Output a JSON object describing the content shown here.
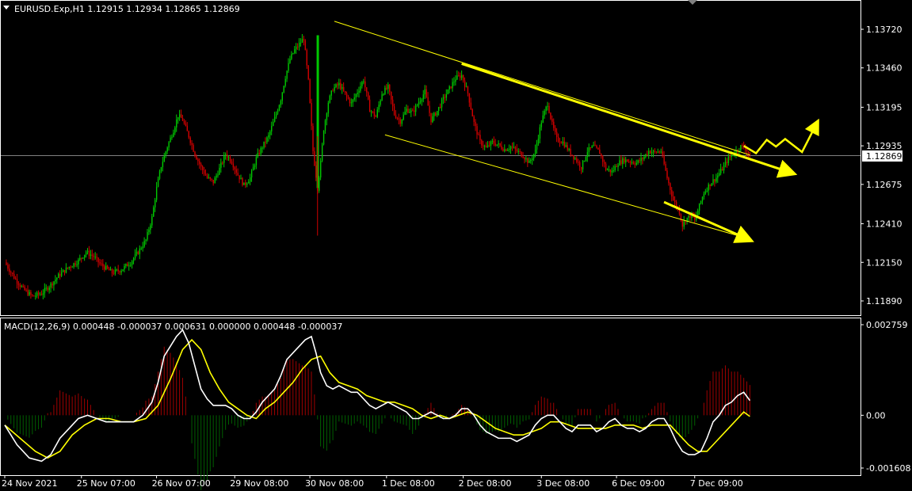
{
  "header": {
    "symbol_line": "EURUSD.Exp,H1  1.12915 1.12934 1.12865 1.12869"
  },
  "macd_header": {
    "text": "MACD(12,26,9) 0.000448 -0.000037 0.000631 0.000000 0.000448 -0.000037"
  },
  "chart_data": [
    {
      "type": "candlestick",
      "symbol": "EURUSD.Exp",
      "timeframe": "H1",
      "ohlc_current": {
        "open": 1.12915,
        "high": 1.12934,
        "low": 1.12865,
        "close": 1.12869
      },
      "current_price_label": "1.12869",
      "current_price": 1.12869,
      "y_ticks": [
        "1.13720",
        "1.13460",
        "1.13195",
        "1.12935",
        "1.12675",
        "1.12410",
        "1.12150",
        "1.11890"
      ],
      "y_tick_values": [
        1.1372,
        1.1346,
        1.13195,
        1.12935,
        1.12675,
        1.1241,
        1.1215,
        1.1189
      ],
      "x_ticks": [
        "24 Nov 2021",
        "25 Nov 07:00",
        "26 Nov 07:00",
        "29 Nov 08:00",
        "30 Nov 08:00",
        "1 Dec 08:00",
        "2 Dec 08:00",
        "3 Dec 08:00",
        "6 Dec 09:00",
        "7 Dec 09:00"
      ],
      "colors": {
        "bull": "#00c800",
        "bear": "#d00000",
        "trend": "#ffff00",
        "price_line": "#808080"
      },
      "close_path": [
        [
          0,
          1.1215
        ],
        [
          6,
          1.1205
        ],
        [
          12,
          1.1197
        ],
        [
          18,
          1.1192
        ],
        [
          24,
          1.1194
        ],
        [
          30,
          1.12
        ],
        [
          36,
          1.1207
        ],
        [
          42,
          1.1212
        ],
        [
          48,
          1.1216
        ],
        [
          53,
          1.1222
        ],
        [
          58,
          1.1219
        ],
        [
          62,
          1.1214
        ],
        [
          66,
          1.1211
        ],
        [
          70,
          1.1208
        ],
        [
          76,
          1.121
        ],
        [
          82,
          1.1215
        ],
        [
          87,
          1.1222
        ],
        [
          92,
          1.123
        ],
        [
          96,
          1.1245
        ],
        [
          99,
          1.1265
        ],
        [
          102,
          1.128
        ],
        [
          106,
          1.1293
        ],
        [
          110,
          1.1304
        ],
        [
          113,
          1.1314
        ],
        [
          116,
          1.1311
        ],
        [
          120,
          1.13
        ],
        [
          124,
          1.1288
        ],
        [
          128,
          1.1279
        ],
        [
          132,
          1.1272
        ],
        [
          136,
          1.1269
        ],
        [
          140,
          1.1278
        ],
        [
          144,
          1.1288
        ],
        [
          148,
          1.1283
        ],
        [
          152,
          1.1274
        ],
        [
          156,
          1.1267
        ],
        [
          160,
          1.1272
        ],
        [
          164,
          1.1285
        ],
        [
          168,
          1.1293
        ],
        [
          172,
          1.13
        ],
        [
          176,
          1.1312
        ],
        [
          180,
          1.1325
        ],
        [
          183,
          1.134
        ],
        [
          186,
          1.1352
        ],
        [
          189,
          1.1358
        ],
        [
          192,
          1.1362
        ],
        [
          195,
          1.1366
        ],
        [
          198,
          1.1337
        ],
        [
          201,
          1.129
        ],
        [
          204,
          1.1265
        ],
        [
          206,
          1.1282
        ],
        [
          208,
          1.1305
        ],
        [
          211,
          1.1323
        ],
        [
          214,
          1.1332
        ],
        [
          218,
          1.1335
        ],
        [
          222,
          1.1328
        ],
        [
          226,
          1.1322
        ],
        [
          230,
          1.133
        ],
        [
          234,
          1.1338
        ],
        [
          238,
          1.1318
        ],
        [
          242,
          1.1313
        ],
        [
          246,
          1.1329
        ],
        [
          250,
          1.1333
        ],
        [
          254,
          1.1315
        ],
        [
          258,
          1.131
        ],
        [
          262,
          1.1318
        ],
        [
          266,
          1.1316
        ],
        [
          270,
          1.1323
        ],
        [
          274,
          1.133
        ],
        [
          278,
          1.1311
        ],
        [
          282,
          1.1317
        ],
        [
          286,
          1.1325
        ],
        [
          290,
          1.1332
        ],
        [
          294,
          1.1339
        ],
        [
          298,
          1.1341
        ],
        [
          302,
          1.1329
        ],
        [
          306,
          1.1309
        ],
        [
          310,
          1.1296
        ],
        [
          314,
          1.1292
        ],
        [
          318,
          1.1296
        ],
        [
          322,
          1.1294
        ],
        [
          326,
          1.1291
        ],
        [
          330,
          1.1293
        ],
        [
          334,
          1.129
        ],
        [
          338,
          1.1287
        ],
        [
          342,
          1.1282
        ],
        [
          346,
          1.129
        ],
        [
          350,
          1.131
        ],
        [
          354,
          1.1322
        ],
        [
          357,
          1.1308
        ],
        [
          360,
          1.1298
        ],
        [
          364,
          1.1296
        ],
        [
          368,
          1.129
        ],
        [
          372,
          1.1285
        ],
        [
          376,
          1.1279
        ],
        [
          380,
          1.129
        ],
        [
          384,
          1.1293
        ],
        [
          388,
          1.1289
        ],
        [
          392,
          1.1278
        ],
        [
          396,
          1.1276
        ],
        [
          400,
          1.1282
        ],
        [
          404,
          1.1284
        ],
        [
          408,
          1.1283
        ],
        [
          412,
          1.1282
        ],
        [
          416,
          1.1285
        ],
        [
          420,
          1.129
        ],
        [
          424,
          1.1289
        ],
        [
          428,
          1.129
        ],
        [
          432,
          1.1272
        ],
        [
          436,
          1.1257
        ],
        [
          440,
          1.1249
        ],
        [
          442,
          1.124
        ],
        [
          444,
          1.1244
        ],
        [
          448,
          1.1247
        ],
        [
          450,
          1.1243
        ],
        [
          452,
          1.125
        ],
        [
          456,
          1.1262
        ],
        [
          460,
          1.1268
        ],
        [
          464,
          1.1272
        ],
        [
          468,
          1.1278
        ],
        [
          472,
          1.1285
        ],
        [
          476,
          1.1289
        ],
        [
          480,
          1.1293
        ],
        [
          483,
          1.1292
        ],
        [
          486,
          1.12869
        ]
      ],
      "trend_lines": [
        {
          "from": [
            215,
            1.13774
          ],
          "to": [
            486,
            1.12873
          ],
          "style": "thin"
        },
        {
          "from": [
            248,
            1.13009
          ],
          "to": [
            486,
            1.12307
          ],
          "style": "thin"
        },
        {
          "from": [
            298,
            1.13488
          ],
          "to": [
            514,
            1.1275
          ],
          "style": "arrow"
        },
        {
          "from": [
            430,
            1.12556
          ],
          "to": [
            486,
            1.123
          ],
          "style": "arrow"
        }
      ],
      "forecast_path": [
        [
          482,
          1.12935
        ],
        [
          490,
          1.12885
        ],
        [
          497,
          1.12975
        ],
        [
          503,
          1.1293
        ],
        [
          509,
          1.12981
        ],
        [
          520,
          1.12893
        ],
        [
          530,
          1.13095
        ]
      ],
      "x_tick_index": [
        0,
        50,
        99,
        150,
        199,
        249,
        299,
        350,
        399,
        450
      ]
    },
    {
      "type": "macd",
      "params": "MACD(12,26,9)",
      "values": {
        "macd": 0.000448,
        "signal": -3.7e-05
      },
      "y_ticks": [
        "0.002759",
        "0.00",
        "-0.001608"
      ],
      "y_tick_values": [
        0.002759,
        0.0,
        -0.001608
      ],
      "colors": {
        "macd_line": "#ffffff",
        "signal_line": "#ffff00",
        "hist_pos": "#a00000",
        "hist_neg": "#006000"
      },
      "macd_path": [
        [
          0,
          -0.0003
        ],
        [
          8,
          -0.0009
        ],
        [
          16,
          -0.0013
        ],
        [
          24,
          -0.0014
        ],
        [
          30,
          -0.0012
        ],
        [
          36,
          -0.0007
        ],
        [
          42,
          -0.0004
        ],
        [
          48,
          -0.0001
        ],
        [
          54,
          0.0
        ],
        [
          60,
          -0.0001
        ],
        [
          66,
          -0.0002
        ],
        [
          72,
          -0.0002
        ],
        [
          78,
          -0.0002
        ],
        [
          84,
          -0.0002
        ],
        [
          90,
          0.0
        ],
        [
          96,
          0.0004
        ],
        [
          100,
          0.001
        ],
        [
          104,
          0.0018
        ],
        [
          108,
          0.0021
        ],
        [
          112,
          0.0024
        ],
        [
          116,
          0.0026
        ],
        [
          120,
          0.0022
        ],
        [
          124,
          0.0015
        ],
        [
          128,
          0.0008
        ],
        [
          132,
          0.0005
        ],
        [
          136,
          0.0003
        ],
        [
          140,
          0.0003
        ],
        [
          144,
          0.0003
        ],
        [
          148,
          0.0002
        ],
        [
          152,
          0.0
        ],
        [
          156,
          -0.0001
        ],
        [
          160,
          -0.0001
        ],
        [
          164,
          0.0001
        ],
        [
          168,
          0.0004
        ],
        [
          172,
          0.0006
        ],
        [
          176,
          0.0008
        ],
        [
          180,
          0.0012
        ],
        [
          184,
          0.0017
        ],
        [
          188,
          0.0019
        ],
        [
          192,
          0.0021
        ],
        [
          196,
          0.0023
        ],
        [
          200,
          0.0024
        ],
        [
          203,
          0.0019
        ],
        [
          206,
          0.0013
        ],
        [
          210,
          0.0009
        ],
        [
          214,
          0.0008
        ],
        [
          218,
          0.0009
        ],
        [
          222,
          0.0008
        ],
        [
          226,
          0.0007
        ],
        [
          230,
          0.0007
        ],
        [
          234,
          0.0005
        ],
        [
          238,
          0.0003
        ],
        [
          242,
          0.0002
        ],
        [
          246,
          0.0003
        ],
        [
          250,
          0.0004
        ],
        [
          254,
          0.0003
        ],
        [
          258,
          0.0002
        ],
        [
          262,
          0.0001
        ],
        [
          266,
          -0.0001
        ],
        [
          270,
          -0.0001
        ],
        [
          274,
          0.0
        ],
        [
          278,
          0.0001
        ],
        [
          282,
          0.0
        ],
        [
          286,
          -0.0001
        ],
        [
          290,
          -0.0001
        ],
        [
          294,
          0.0
        ],
        [
          298,
          0.0002
        ],
        [
          302,
          0.0002
        ],
        [
          306,
          0.0
        ],
        [
          310,
          -0.0003
        ],
        [
          314,
          -0.0005
        ],
        [
          318,
          -0.0006
        ],
        [
          322,
          -0.0007
        ],
        [
          326,
          -0.0007
        ],
        [
          330,
          -0.0007
        ],
        [
          334,
          -0.0008
        ],
        [
          338,
          -0.0007
        ],
        [
          342,
          -0.0006
        ],
        [
          346,
          -0.0003
        ],
        [
          350,
          -0.0001
        ],
        [
          354,
          0.0
        ],
        [
          358,
          0.0
        ],
        [
          362,
          -0.0002
        ],
        [
          366,
          -0.0004
        ],
        [
          370,
          -0.0005
        ],
        [
          374,
          -0.0003
        ],
        [
          378,
          -0.0003
        ],
        [
          382,
          -0.0003
        ],
        [
          386,
          -0.0005
        ],
        [
          390,
          -0.0004
        ],
        [
          394,
          -0.0002
        ],
        [
          398,
          -0.0001
        ],
        [
          402,
          -0.0003
        ],
        [
          406,
          -0.0004
        ],
        [
          410,
          -0.0004
        ],
        [
          414,
          -0.0005
        ],
        [
          418,
          -0.0004
        ],
        [
          422,
          -0.0002
        ],
        [
          426,
          -0.0001
        ],
        [
          430,
          -0.0001
        ],
        [
          434,
          -0.0004
        ],
        [
          438,
          -0.0008
        ],
        [
          442,
          -0.0011
        ],
        [
          446,
          -0.0012
        ],
        [
          450,
          -0.0012
        ],
        [
          454,
          -0.0011
        ],
        [
          458,
          -0.0007
        ],
        [
          462,
          -0.0002
        ],
        [
          466,
          0.0
        ],
        [
          470,
          0.0003
        ],
        [
          474,
          0.0004
        ],
        [
          478,
          0.0006
        ],
        [
          482,
          0.0007
        ],
        [
          486,
          0.000448
        ]
      ],
      "signal_path": [
        [
          0,
          -0.0003
        ],
        [
          10,
          -0.0007
        ],
        [
          20,
          -0.0011
        ],
        [
          28,
          -0.0013
        ],
        [
          36,
          -0.0011
        ],
        [
          44,
          -0.0006
        ],
        [
          52,
          -0.0003
        ],
        [
          60,
          -0.0001
        ],
        [
          68,
          -0.0001
        ],
        [
          76,
          -0.0002
        ],
        [
          84,
          -0.0002
        ],
        [
          92,
          -0.0001
        ],
        [
          100,
          0.0003
        ],
        [
          108,
          0.0011
        ],
        [
          116,
          0.002
        ],
        [
          122,
          0.0023
        ],
        [
          128,
          0.002
        ],
        [
          134,
          0.0013
        ],
        [
          140,
          0.0008
        ],
        [
          146,
          0.0004
        ],
        [
          152,
          0.0002
        ],
        [
          158,
          0.0
        ],
        [
          164,
          -0.0001
        ],
        [
          170,
          0.0002
        ],
        [
          176,
          0.0004
        ],
        [
          182,
          0.0007
        ],
        [
          188,
          0.001
        ],
        [
          194,
          0.0014
        ],
        [
          200,
          0.0017
        ],
        [
          206,
          0.0018
        ],
        [
          212,
          0.0013
        ],
        [
          218,
          0.001
        ],
        [
          224,
          0.0009
        ],
        [
          230,
          0.0008
        ],
        [
          236,
          0.0006
        ],
        [
          242,
          0.0005
        ],
        [
          248,
          0.0004
        ],
        [
          254,
          0.0004
        ],
        [
          260,
          0.0003
        ],
        [
          266,
          0.0002
        ],
        [
          272,
          0.0
        ],
        [
          278,
          -0.0001
        ],
        [
          284,
          0.0
        ],
        [
          290,
          -0.0001
        ],
        [
          296,
          0.0
        ],
        [
          302,
          0.0001
        ],
        [
          308,
          0.0
        ],
        [
          314,
          -0.0002
        ],
        [
          320,
          -0.0004
        ],
        [
          326,
          -0.0005
        ],
        [
          332,
          -0.0006
        ],
        [
          338,
          -0.0006
        ],
        [
          344,
          -0.0005
        ],
        [
          350,
          -0.0004
        ],
        [
          356,
          -0.0002
        ],
        [
          362,
          -0.0002
        ],
        [
          368,
          -0.0003
        ],
        [
          374,
          -0.0004
        ],
        [
          380,
          -0.0004
        ],
        [
          386,
          -0.0004
        ],
        [
          392,
          -0.0004
        ],
        [
          398,
          -0.0003
        ],
        [
          404,
          -0.0003
        ],
        [
          410,
          -0.0003
        ],
        [
          416,
          -0.0004
        ],
        [
          422,
          -0.0003
        ],
        [
          428,
          -0.0003
        ],
        [
          434,
          -0.0003
        ],
        [
          440,
          -0.0006
        ],
        [
          446,
          -0.0009
        ],
        [
          452,
          -0.0011
        ],
        [
          458,
          -0.0011
        ],
        [
          464,
          -0.0008
        ],
        [
          470,
          -0.0005
        ],
        [
          476,
          -0.0002
        ],
        [
          482,
          0.0001
        ],
        [
          486,
          -3.7e-05
        ]
      ]
    }
  ]
}
